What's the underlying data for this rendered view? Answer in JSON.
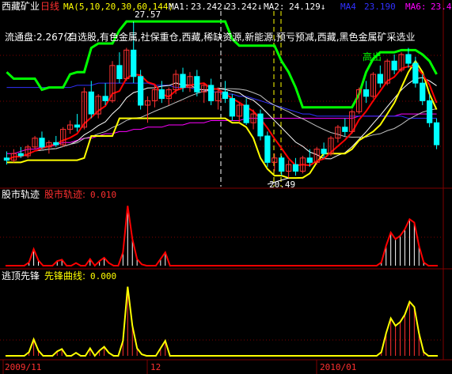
{
  "header": {
    "stock_name": "西藏矿业",
    "period": "日线",
    "ma_label": "MA(5,10,20,30,60,144)",
    "ma1_label": "MA1:",
    "ma1_value": "23.242↓",
    "ma1_value2": "23.242↓",
    "ma2_label": "MA2:",
    "ma2_value": "24.129↓",
    "ma4_label": "MA4",
    "ma4_value": "23.190",
    "ma6_label": "MA6:",
    "ma6_value": "23.4"
  },
  "main_panel": {
    "float_label": "流通盘:2.267亿",
    "concepts": "自选股,有色金属,社保重仓,西藏,稀缺资源,新能源,预亏预减,西藏,黑色金属矿采选业",
    "high_marker": "27.57",
    "low_marker": "20.49",
    "exit_signal": "高出"
  },
  "panel2": {
    "title": "股市轨迹",
    "line_label": "股市轨迹:",
    "line_value": "0.010"
  },
  "panel3": {
    "title": "逃顶先锋",
    "line_label": "先锋曲线:",
    "line_value": "0.000"
  },
  "x_axis": {
    "labels": [
      "2009/11",
      "12",
      "2010/01"
    ]
  },
  "colors": {
    "up_candle": "#ff3232",
    "down_candle": "#00ffff",
    "ma_white": "#ffffff",
    "ma_yellow": "#ffff00",
    "ma_magenta": "#ff00ff",
    "ma_blue": "#3030ff",
    "channel_green": "#00ff00",
    "channel_yellow": "#ffff00",
    "trend_red": "#ff0000",
    "panel_red": "#ff0000",
    "panel_yellow": "#ffff00",
    "grid": "#800000"
  },
  "chart_data": [
    {
      "type": "candlestick",
      "candles": [
        {
          "o": 21.4,
          "h": 21.7,
          "l": 21.1,
          "c": 21.3
        },
        {
          "o": 21.3,
          "h": 21.8,
          "l": 21.2,
          "c": 21.6
        },
        {
          "o": 21.6,
          "h": 21.9,
          "l": 21.4,
          "c": 21.5
        },
        {
          "o": 21.5,
          "h": 22.0,
          "l": 21.4,
          "c": 21.9
        },
        {
          "o": 21.9,
          "h": 22.4,
          "l": 21.8,
          "c": 22.3
        },
        {
          "o": 22.3,
          "h": 22.6,
          "l": 21.8,
          "c": 21.9
        },
        {
          "o": 21.9,
          "h": 22.2,
          "l": 21.6,
          "c": 22.1
        },
        {
          "o": 22.1,
          "h": 22.4,
          "l": 21.9,
          "c": 22.0
        },
        {
          "o": 22.0,
          "h": 22.8,
          "l": 21.9,
          "c": 22.7
        },
        {
          "o": 22.7,
          "h": 23.1,
          "l": 22.5,
          "c": 22.9
        },
        {
          "o": 22.9,
          "h": 23.4,
          "l": 22.6,
          "c": 22.8
        },
        {
          "o": 22.8,
          "h": 24.6,
          "l": 22.7,
          "c": 24.4
        },
        {
          "o": 24.4,
          "h": 24.9,
          "l": 23.2,
          "c": 23.4
        },
        {
          "o": 23.4,
          "h": 24.3,
          "l": 23.2,
          "c": 24.2
        },
        {
          "o": 24.2,
          "h": 24.8,
          "l": 23.8,
          "c": 24.0
        },
        {
          "o": 24.0,
          "h": 25.8,
          "l": 23.9,
          "c": 25.6
        },
        {
          "o": 25.6,
          "h": 26.2,
          "l": 24.8,
          "c": 25.0
        },
        {
          "o": 25.0,
          "h": 26.4,
          "l": 24.9,
          "c": 26.3
        },
        {
          "o": 26.3,
          "h": 27.57,
          "l": 24.8,
          "c": 25.1
        },
        {
          "o": 25.1,
          "h": 25.4,
          "l": 23.6,
          "c": 23.8
        },
        {
          "o": 23.8,
          "h": 24.2,
          "l": 23.0,
          "c": 24.0
        },
        {
          "o": 24.0,
          "h": 24.7,
          "l": 23.7,
          "c": 24.5
        },
        {
          "o": 24.5,
          "h": 24.9,
          "l": 23.9,
          "c": 24.1
        },
        {
          "o": 24.1,
          "h": 24.6,
          "l": 23.8,
          "c": 24.5
        },
        {
          "o": 24.5,
          "h": 25.4,
          "l": 24.3,
          "c": 25.2
        },
        {
          "o": 25.2,
          "h": 25.5,
          "l": 24.4,
          "c": 24.6
        },
        {
          "o": 24.6,
          "h": 25.3,
          "l": 24.4,
          "c": 25.1
        },
        {
          "o": 25.1,
          "h": 25.4,
          "l": 24.2,
          "c": 24.4
        },
        {
          "o": 24.4,
          "h": 24.8,
          "l": 23.9,
          "c": 24.7
        },
        {
          "o": 24.7,
          "h": 25.0,
          "l": 23.8,
          "c": 24.0
        },
        {
          "o": 24.0,
          "h": 24.6,
          "l": 23.6,
          "c": 24.4
        },
        {
          "o": 24.4,
          "h": 24.9,
          "l": 23.9,
          "c": 24.1
        },
        {
          "o": 24.1,
          "h": 24.3,
          "l": 23.1,
          "c": 23.3
        },
        {
          "o": 23.3,
          "h": 23.9,
          "l": 23.0,
          "c": 23.8
        },
        {
          "o": 23.8,
          "h": 24.1,
          "l": 22.9,
          "c": 23.0
        },
        {
          "o": 23.0,
          "h": 23.6,
          "l": 22.7,
          "c": 23.4
        },
        {
          "o": 23.4,
          "h": 23.6,
          "l": 22.2,
          "c": 22.4
        },
        {
          "o": 22.4,
          "h": 22.6,
          "l": 21.0,
          "c": 21.2
        },
        {
          "o": 21.2,
          "h": 21.6,
          "l": 20.8,
          "c": 21.4
        },
        {
          "o": 21.4,
          "h": 21.5,
          "l": 20.6,
          "c": 20.8
        },
        {
          "o": 20.8,
          "h": 21.3,
          "l": 20.49,
          "c": 21.1
        },
        {
          "o": 21.1,
          "h": 21.4,
          "l": 20.6,
          "c": 20.8
        },
        {
          "o": 20.8,
          "h": 21.5,
          "l": 20.7,
          "c": 21.4
        },
        {
          "o": 21.4,
          "h": 21.8,
          "l": 21.0,
          "c": 21.2
        },
        {
          "o": 21.2,
          "h": 21.9,
          "l": 21.1,
          "c": 21.8
        },
        {
          "o": 21.8,
          "h": 22.1,
          "l": 21.4,
          "c": 21.6
        },
        {
          "o": 21.6,
          "h": 22.4,
          "l": 21.5,
          "c": 22.3
        },
        {
          "o": 22.3,
          "h": 22.9,
          "l": 22.1,
          "c": 22.8
        },
        {
          "o": 22.8,
          "h": 23.2,
          "l": 22.4,
          "c": 22.6
        },
        {
          "o": 22.6,
          "h": 23.6,
          "l": 22.5,
          "c": 23.5
        },
        {
          "o": 23.5,
          "h": 24.6,
          "l": 23.4,
          "c": 24.5
        },
        {
          "o": 24.5,
          "h": 24.9,
          "l": 23.9,
          "c": 24.2
        },
        {
          "o": 24.2,
          "h": 25.3,
          "l": 24.1,
          "c": 25.2
        },
        {
          "o": 25.2,
          "h": 25.6,
          "l": 24.6,
          "c": 24.8
        },
        {
          "o": 24.8,
          "h": 25.9,
          "l": 24.7,
          "c": 25.8
        },
        {
          "o": 25.8,
          "h": 26.1,
          "l": 25.2,
          "c": 25.4
        },
        {
          "o": 25.4,
          "h": 26.2,
          "l": 25.3,
          "c": 26.1
        },
        {
          "o": 26.1,
          "h": 26.4,
          "l": 25.5,
          "c": 25.7
        },
        {
          "o": 25.7,
          "h": 26.0,
          "l": 24.6,
          "c": 24.8
        },
        {
          "o": 24.8,
          "h": 25.2,
          "l": 23.8,
          "c": 24.0
        },
        {
          "o": 24.0,
          "h": 24.3,
          "l": 22.8,
          "c": 23.0
        },
        {
          "o": 23.0,
          "h": 23.2,
          "l": 21.8,
          "c": 22.0
        }
      ],
      "y_range": [
        20.1,
        28.0
      ],
      "channel_upper": [
        25.3,
        25.0,
        25.0,
        25.0,
        25.0,
        24.5,
        24.6,
        24.6,
        24.6,
        25.2,
        25.3,
        25.3,
        26.4,
        26.6,
        26.6,
        26.6,
        27.2,
        27.6,
        27.6,
        27.6,
        27.6,
        27.6,
        27.6,
        27.6,
        27.6,
        27.6,
        27.6,
        27.6,
        27.6,
        27.6,
        27.6,
        27.6,
        26.8,
        26.5,
        26.5,
        26.5,
        26.5,
        26.5,
        26.5,
        25.8,
        25.3,
        24.6,
        23.7,
        23.7,
        23.7,
        23.7,
        23.7,
        23.7,
        23.7,
        23.7,
        24.3,
        25.3,
        25.9,
        26.2,
        26.2,
        26.2,
        26.3,
        26.3,
        26.3,
        26.1,
        25.8,
        25.2
      ],
      "channel_lower": [
        21.2,
        21.2,
        21.2,
        21.3,
        21.3,
        21.3,
        21.3,
        21.3,
        21.3,
        21.3,
        21.3,
        21.4,
        22.4,
        22.4,
        22.4,
        22.4,
        23.2,
        23.2,
        23.2,
        23.2,
        23.2,
        23.2,
        23.2,
        23.2,
        23.2,
        23.2,
        23.2,
        23.2,
        23.2,
        23.2,
        23.2,
        23.2,
        23.0,
        23.0,
        22.8,
        22.3,
        21.4,
        20.9,
        20.6,
        20.6,
        20.49,
        20.49,
        20.5,
        20.7,
        21.2,
        21.6,
        21.6,
        21.6,
        21.6,
        21.8,
        22.2,
        22.4,
        22.6,
        22.9,
        23.4,
        23.9,
        24.6,
        25.3,
        25.8,
        25.3,
        24.3,
        23.6
      ],
      "ma_blue": [
        24.6,
        24.6,
        24.6,
        24.6,
        24.6,
        24.6,
        24.6,
        24.6,
        24.6,
        24.6,
        24.7,
        24.7,
        24.7,
        24.8,
        24.8,
        24.8,
        24.8,
        24.8,
        24.8,
        24.8,
        24.8,
        24.7,
        24.7,
        24.7,
        24.6,
        24.6,
        24.6,
        24.5,
        24.5,
        24.4,
        24.4,
        24.3,
        24.3,
        24.2,
        24.2,
        24.1,
        24.0,
        23.9,
        23.8,
        23.7,
        23.6,
        23.5,
        23.4,
        23.4,
        23.3,
        23.3,
        23.3,
        23.3,
        23.3,
        23.3,
        23.3,
        23.3,
        23.3,
        23.3,
        23.3,
        23.3,
        23.3,
        23.2,
        23.2,
        23.2,
        23.2,
        23.2
      ],
      "ma_magenta": [
        21.6,
        21.6,
        21.7,
        21.8,
        21.8,
        21.9,
        21.9,
        22.0,
        22.1,
        22.1,
        22.2,
        22.3,
        22.3,
        22.4,
        22.5,
        22.5,
        22.6,
        22.6,
        22.7,
        22.7,
        22.8,
        22.8,
        22.8,
        22.9,
        22.9,
        22.9,
        23.0,
        23.0,
        23.0,
        23.1,
        23.1,
        23.1,
        23.1,
        23.1,
        23.2,
        23.2,
        23.2,
        23.2,
        23.2,
        23.2,
        23.2,
        23.2,
        23.2,
        23.2,
        23.2,
        23.2,
        23.2,
        23.2,
        23.2,
        23.2,
        23.3,
        23.3,
        23.3,
        23.3,
        23.3,
        23.3,
        23.4,
        23.4,
        23.4,
        23.4,
        23.4,
        23.4
      ]
    },
    {
      "type": "line",
      "name": "股市轨迹",
      "values": [
        0,
        0,
        0,
        0,
        0,
        0.05,
        0.25,
        0.08,
        0,
        0,
        0,
        0.07,
        0.09,
        0,
        0,
        0.04,
        0,
        0,
        0.1,
        0,
        0.07,
        0.12,
        0.04,
        0,
        0,
        0.2,
        0.9,
        0.4,
        0.1,
        0.02,
        0,
        0,
        0,
        0.1,
        0.2,
        0,
        0,
        0,
        0,
        0,
        0,
        0,
        0,
        0,
        0,
        0,
        0,
        0,
        0,
        0,
        0,
        0,
        0,
        0,
        0,
        0,
        0,
        0,
        0,
        0,
        0,
        0,
        0,
        0,
        0,
        0,
        0,
        0,
        0,
        0,
        0,
        0,
        0,
        0,
        0,
        0,
        0,
        0,
        0,
        0,
        0.05,
        0.3,
        0.5,
        0.4,
        0.45,
        0.55,
        0.7,
        0.65,
        0.3,
        0.05,
        0,
        0,
        0
      ],
      "y_range": [
        0,
        1
      ]
    },
    {
      "type": "line",
      "name": "先锋曲线",
      "values": [
        0,
        0,
        0,
        0,
        0,
        0.05,
        0.22,
        0.07,
        0,
        0,
        0,
        0.06,
        0.09,
        0,
        0,
        0.04,
        0,
        0,
        0.1,
        0,
        0.07,
        0.12,
        0.04,
        0,
        0,
        0.2,
        0.92,
        0.4,
        0.1,
        0.02,
        0,
        0,
        0,
        0.1,
        0.2,
        0,
        0,
        0,
        0,
        0,
        0,
        0,
        0,
        0,
        0,
        0,
        0,
        0,
        0,
        0,
        0,
        0,
        0,
        0,
        0,
        0,
        0,
        0,
        0,
        0,
        0,
        0,
        0,
        0,
        0,
        0,
        0,
        0,
        0,
        0,
        0,
        0,
        0,
        0,
        0,
        0,
        0,
        0,
        0,
        0,
        0.05,
        0.3,
        0.5,
        0.4,
        0.45,
        0.55,
        0.72,
        0.65,
        0.3,
        0.05,
        0,
        0,
        0
      ],
      "y_range": [
        0,
        1
      ]
    }
  ]
}
